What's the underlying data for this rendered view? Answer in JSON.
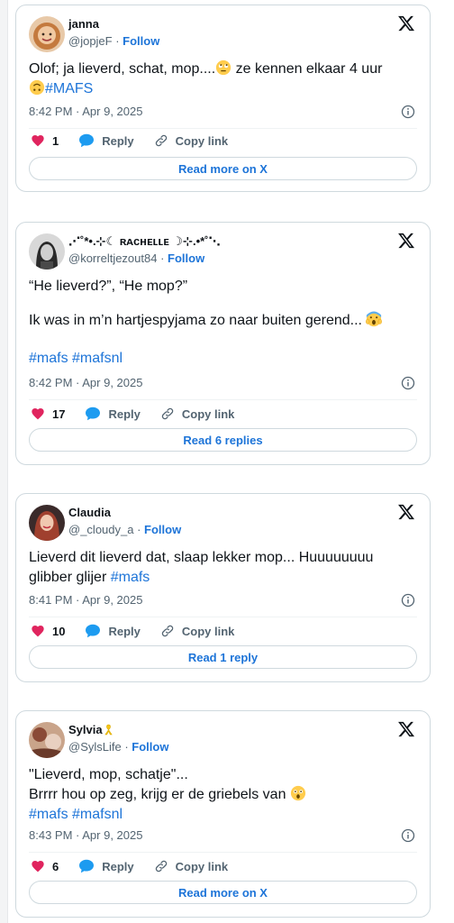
{
  "tweets": [
    {
      "display_name": "janna",
      "handle": "@jopjeF",
      "follow": "Follow",
      "text_line1": "Olof; ja lieverd, schat, mop....",
      "text_line1b": " ze kennen elkaar 4 uur",
      "hashtag1": "#MAFS",
      "timestamp": "8:42 PM · Apr 9, 2025",
      "likes": "1",
      "reply": "Reply",
      "copy": "Copy link",
      "cta": "Read more on X",
      "avatar_color": "#d08a52"
    },
    {
      "display_name": "⋰˚*•.⊹☾ ʀᴀᴄʜᴇʟʟᴇ ☽⊹.•*˚⋱",
      "handle": "@korreltjezout84",
      "follow": "Follow",
      "text_line1": "“He lieverd?”, “He mop?”",
      "text_line2": "Ik was in m’n hartjespyjama zo naar buiten gerend...",
      "hashtag1": "#mafs",
      "hashtag2": "#mafsnl",
      "timestamp": "8:42 PM · Apr 9, 2025",
      "likes": "17",
      "reply": "Reply",
      "copy": "Copy link",
      "cta": "Read 6 replies",
      "avatar_color": "#6b6b6b"
    },
    {
      "display_name": "Claudia",
      "handle": "@_cloudy_a",
      "follow": "Follow",
      "text_line1": "Lieverd dit lieverd dat, slaap lekker mop... Huuuuuuuu",
      "text_line2": "glibber glijer ",
      "hashtag1": "#mafs",
      "timestamp": "8:41 PM · Apr 9, 2025",
      "likes": "10",
      "reply": "Reply",
      "copy": "Copy link",
      "cta": "Read 1 reply",
      "avatar_color": "#b85a4a"
    },
    {
      "display_name": "Sylvia",
      "handle": "@SylsLife",
      "follow": "Follow",
      "text_line1": "\"Lieverd, mop, schatje\"...",
      "text_line2": "Brrrr hou op zeg, krijg er de griebels van ",
      "hashtag1": "#mafs",
      "hashtag2": "#mafsnl",
      "timestamp": "8:43 PM · Apr 9, 2025",
      "likes": "6",
      "reply": "Reply",
      "copy": "Copy link",
      "cta": "Read more on X",
      "avatar_color": "#9a6a52"
    }
  ],
  "colors": {
    "link": "#1d74d8",
    "like": "#e0245e",
    "reply": "#1d9bf0",
    "muted": "#536471",
    "border": "#cfd9de"
  },
  "icons": [
    "x-logo-icon",
    "info-icon",
    "heart-icon",
    "reply-bubble-icon",
    "copy-link-icon",
    "face-with-rolling-eyes-emoji",
    "upside-down-face-emoji",
    "screaming-face-emoji",
    "astonished-face-emoji",
    "yellow-ribbon-emoji"
  ]
}
